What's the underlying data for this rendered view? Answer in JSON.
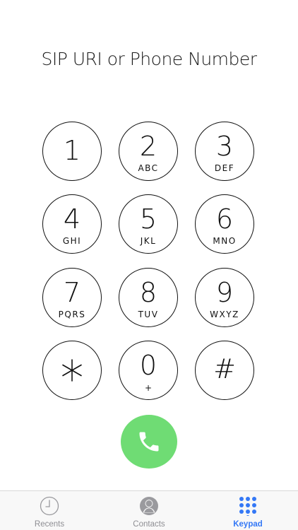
{
  "display": {
    "placeholder": "SIP URI or Phone Number"
  },
  "keypad": {
    "keys": [
      {
        "digit": "1",
        "letters": ""
      },
      {
        "digit": "2",
        "letters": "ABC"
      },
      {
        "digit": "3",
        "letters": "DEF"
      },
      {
        "digit": "4",
        "letters": "GHI"
      },
      {
        "digit": "5",
        "letters": "JKL"
      },
      {
        "digit": "6",
        "letters": "MNO"
      },
      {
        "digit": "7",
        "letters": "PQRS"
      },
      {
        "digit": "8",
        "letters": "TUV"
      },
      {
        "digit": "9",
        "letters": "WXYZ"
      },
      {
        "digit": "*",
        "letters": ""
      },
      {
        "digit": "0",
        "letters": "+"
      },
      {
        "digit": "#",
        "letters": ""
      }
    ],
    "call_icon": "phone-icon"
  },
  "colors": {
    "call_button": "#6fdc74",
    "active_tab": "#3478f6",
    "inactive_tab": "#8e8e93"
  },
  "tabs": [
    {
      "label": "Recents",
      "icon": "clock-icon",
      "active": false
    },
    {
      "label": "Contacts",
      "icon": "person-icon",
      "active": false
    },
    {
      "label": "Keypad",
      "icon": "keypad-icon",
      "active": true
    }
  ]
}
